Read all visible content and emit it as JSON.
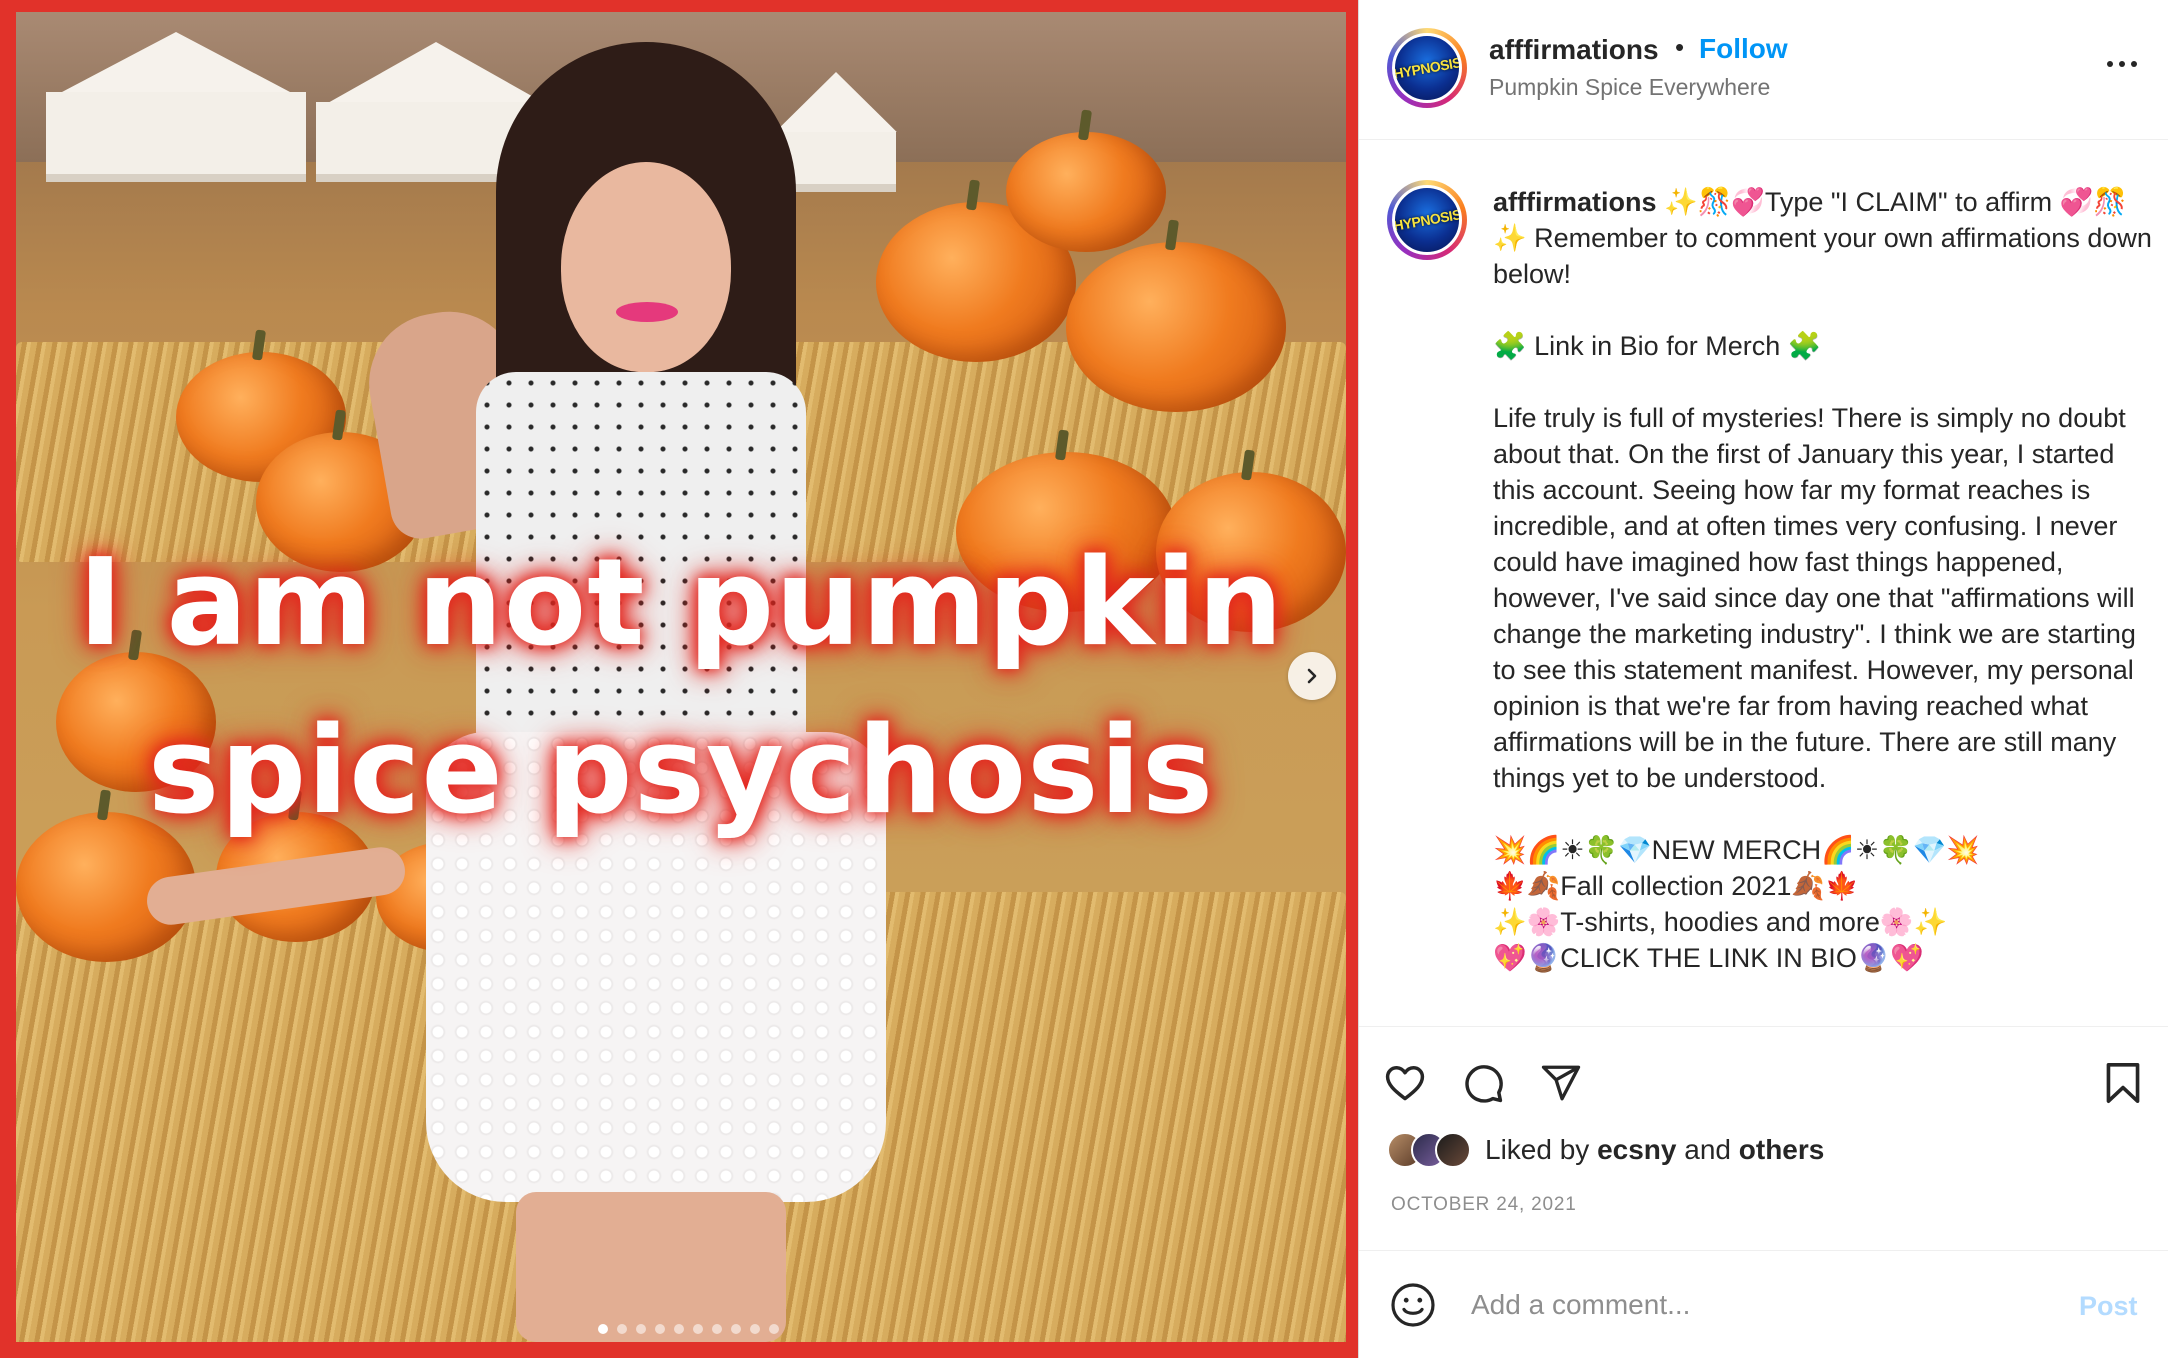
{
  "media": {
    "overlay_line1": "I am not pumpkin",
    "overlay_line2": "spice psychosis",
    "next_icon": "chevron-right-icon",
    "carousel_slides": 10,
    "active_slide": 1,
    "accent_color": "#e1322a"
  },
  "header": {
    "avatar_text": "HYPNOSIS",
    "username": "afffirmations",
    "separator": "•",
    "follow_label": "Follow",
    "subtitle": "Pumpkin Spice Everywhere",
    "more_icon": "more-options-icon"
  },
  "caption": {
    "avatar_text": "HYPNOSIS",
    "username": "afffirmations",
    "body": " ✨🎊💞Type \"I CLAIM\" to affirm 💞🎊✨ Remember to comment your own affirmations down below!\n\n🧩 Link in Bio for Merch 🧩\n\nLife truly is full of mysteries! There is simply no doubt about that. On the first of January this year, I started this account. Seeing how far my format reaches is incredible, and at often times very confusing. I never could have imagined how fast things happened, however, I've said since day one that \"affirmations will change the marketing industry\". I think we are starting to see this statement manifest. However, my personal opinion is that we're far from having reached what affirmations will be in the future. There are still many things yet to be understood.\n\n💥🌈☀🍀💎NEW MERCH🌈☀🍀💎💥\n🍁🍂Fall collection 2021🍂🍁\n✨🌸T-shirts, hoodies and more🌸✨\n💖🔮CLICK THE LINK IN BIO🔮💖"
  },
  "actions": {
    "like_icon": "heart-icon",
    "comment_icon": "comment-icon",
    "share_icon": "share-icon",
    "save_icon": "bookmark-icon"
  },
  "likes": {
    "prefix": "Liked by",
    "user": "ecsny",
    "joiner": "and",
    "others": "others"
  },
  "date": "OCTOBER 24, 2021",
  "comment": {
    "emoji_icon": "smiley-icon",
    "placeholder": "Add a comment...",
    "post_label": "Post"
  }
}
